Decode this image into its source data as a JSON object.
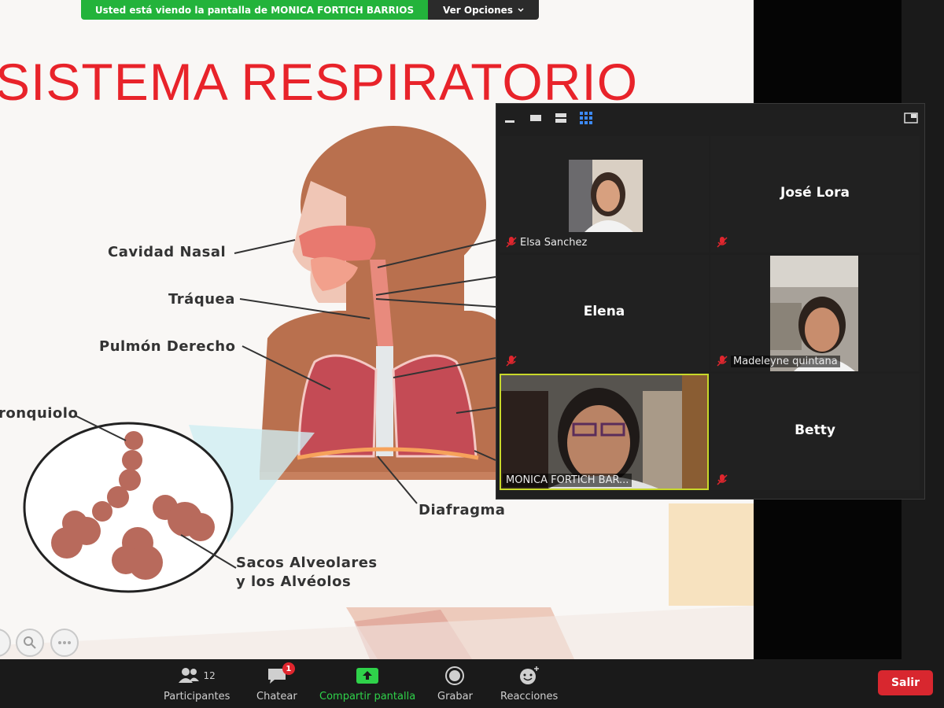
{
  "banner": {
    "message": "Usted está viendo la pantalla de  MONICA FORTICH BARRIOS",
    "options_label": "Ver Opciones"
  },
  "slide": {
    "title": "SISTEMA RESPIRATORIO",
    "labels": {
      "nasal": "Cavidad Nasal",
      "trachea": "Tráquea",
      "right_lung": "Pulmón Derecho",
      "bronchiole": "ronquiolo",
      "diaphragm": "Diafragma",
      "alveoli_line1": "Sacos Alveolares",
      "alveoli_line2": "y los Alvéolos"
    },
    "colors": {
      "title": "#e8232a",
      "body": "#b5694a",
      "lung": "#c9515b"
    }
  },
  "gallery": {
    "participants": [
      {
        "name": "Elsa Sanchez",
        "muted": true,
        "video": true
      },
      {
        "name": "José Lora",
        "muted": true,
        "video": false
      },
      {
        "name": "Elena",
        "muted": true,
        "video": false
      },
      {
        "name": "Madeleyne quintana",
        "muted": true,
        "video": true
      },
      {
        "name": "MONICA FORTICH BAR...",
        "muted": false,
        "video": true,
        "active_speaker": true
      },
      {
        "name": "Betty",
        "muted": true,
        "video": false
      }
    ]
  },
  "toolbar": {
    "participants_label": "Participantes",
    "participants_count": "12",
    "chat_label": "Chatear",
    "chat_badge": "1",
    "share_label": "Compartir pantalla",
    "record_label": "Grabar",
    "reactions_label": "Reacciones",
    "leave_label": "Salir",
    "share_color": "#2fd24a"
  }
}
